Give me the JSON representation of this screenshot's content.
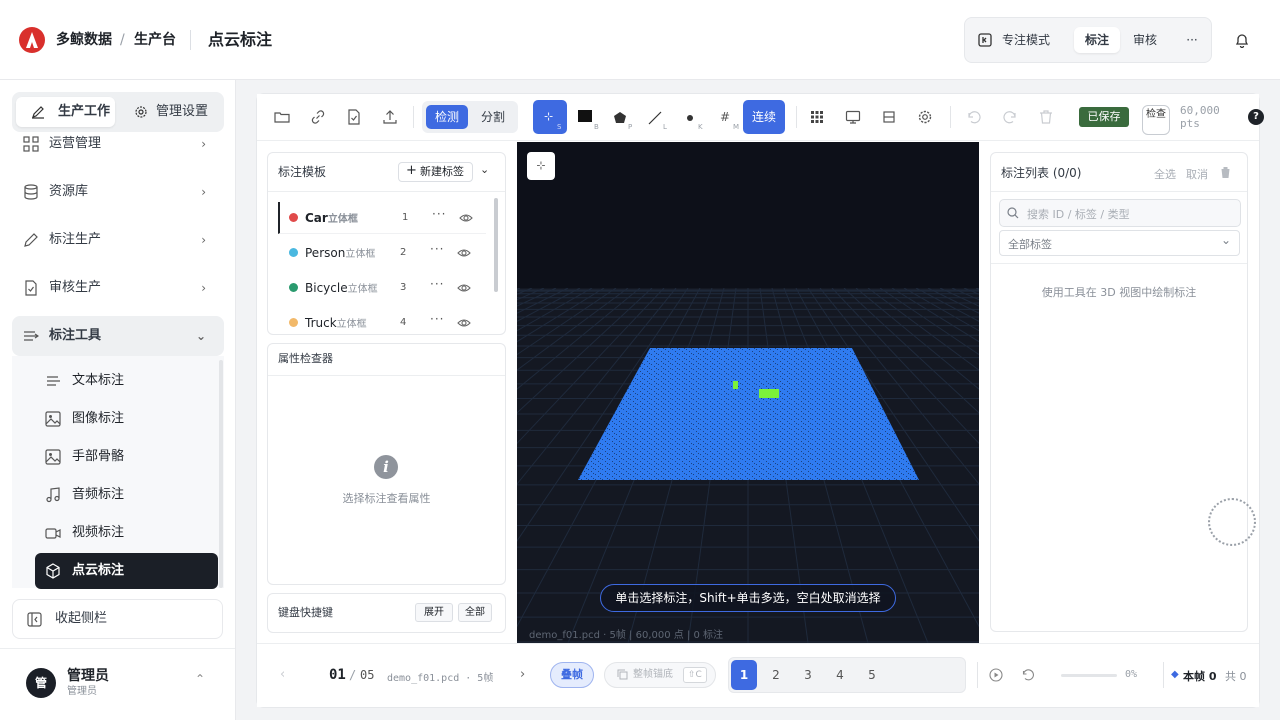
{
  "header": {
    "brand": "多鲸数据",
    "separator": "/",
    "section": "生产台",
    "title": "点云标注",
    "modes": {
      "focus": "专注模式",
      "annotate": "标注",
      "review": "审核",
      "more": "···"
    }
  },
  "sidebar": {
    "tabs": [
      "生产工作",
      "管理设置"
    ],
    "items": [
      {
        "label": "运营管理",
        "icon": "grid-icon"
      },
      {
        "label": "资源库",
        "icon": "database-icon"
      },
      {
        "label": "标注生产",
        "icon": "pen-icon"
      },
      {
        "label": "审核生产",
        "icon": "check-doc-icon"
      },
      {
        "label": "标注工具",
        "icon": "tool-icon"
      }
    ],
    "subitems": [
      {
        "label": "文本标注",
        "icon": "text-icon"
      },
      {
        "label": "图像标注",
        "icon": "image-icon"
      },
      {
        "label": "手部骨骼",
        "icon": "image-icon"
      },
      {
        "label": "音频标注",
        "icon": "music-icon"
      },
      {
        "label": "视频标注",
        "icon": "video-icon"
      },
      {
        "label": "点云标注",
        "icon": "cube-icon"
      }
    ],
    "collapse_label": "收起侧栏",
    "user": {
      "avatar": "管",
      "name": "管理员",
      "role": "管理员"
    }
  },
  "toolbar": {
    "modes": [
      "检测",
      "分割"
    ],
    "tools": [
      {
        "icon": "select-icon",
        "key": "S"
      },
      {
        "icon": "box-icon",
        "key": "B"
      },
      {
        "icon": "polygon-icon",
        "key": "P"
      },
      {
        "icon": "line-icon",
        "key": "L"
      },
      {
        "icon": "point-icon",
        "key": "K"
      },
      {
        "icon": "measure-icon",
        "key": "M"
      }
    ],
    "continuous": "连续",
    "saved": "已保存",
    "check": "检查",
    "points_count": "60,000",
    "points_unit": "pts",
    "help": "?"
  },
  "label_panel": {
    "title": "标注模板",
    "new_label": "新建标签",
    "labels": [
      {
        "name": "Car",
        "type": "立体框",
        "key": "1",
        "color": "#e04a4a"
      },
      {
        "name": "Person",
        "type": "立体框",
        "key": "2",
        "color": "#4ab8e0"
      },
      {
        "name": "Bicycle",
        "type": "立体框",
        "key": "3",
        "color": "#2a9a6e"
      },
      {
        "name": "Truck",
        "type": "立体框",
        "key": "4",
        "color": "#f2b96a"
      }
    ]
  },
  "inspector": {
    "title": "属性检查器",
    "empty": "选择标注查看属性"
  },
  "shortcuts": {
    "title": "键盘快捷键",
    "expand": "展开",
    "all": "全部"
  },
  "viewport": {
    "hint": "单击选择标注，Shift+单击多选，空白处取消选择",
    "status": "demo_f01.pcd · 5帧 | 60,000 点 | 0 标注",
    "colors": {
      "cloud": "#2f7bf0",
      "box": "#7cf23a",
      "background": "#141822"
    }
  },
  "annotation_list": {
    "title": "标注列表 (0/0)",
    "select_all": "全选",
    "cancel": "取消",
    "search_placeholder": "搜索 ID / 标签 / 类型",
    "filter": "全部标签",
    "empty": "使用工具在 3D 视图中绘制标注"
  },
  "timeline": {
    "current": "01",
    "separator": "/",
    "total": "05",
    "file": "demo_f01.pcd · 5帧",
    "stack": "叠帧",
    "anchor": "整帧锚底",
    "anchor_key": "⇧C",
    "frames": [
      "1",
      "2",
      "3",
      "4",
      "5"
    ],
    "progress": "0%",
    "progress_value": 0,
    "this_frame": "本帧 0",
    "total_count": "共 0"
  }
}
